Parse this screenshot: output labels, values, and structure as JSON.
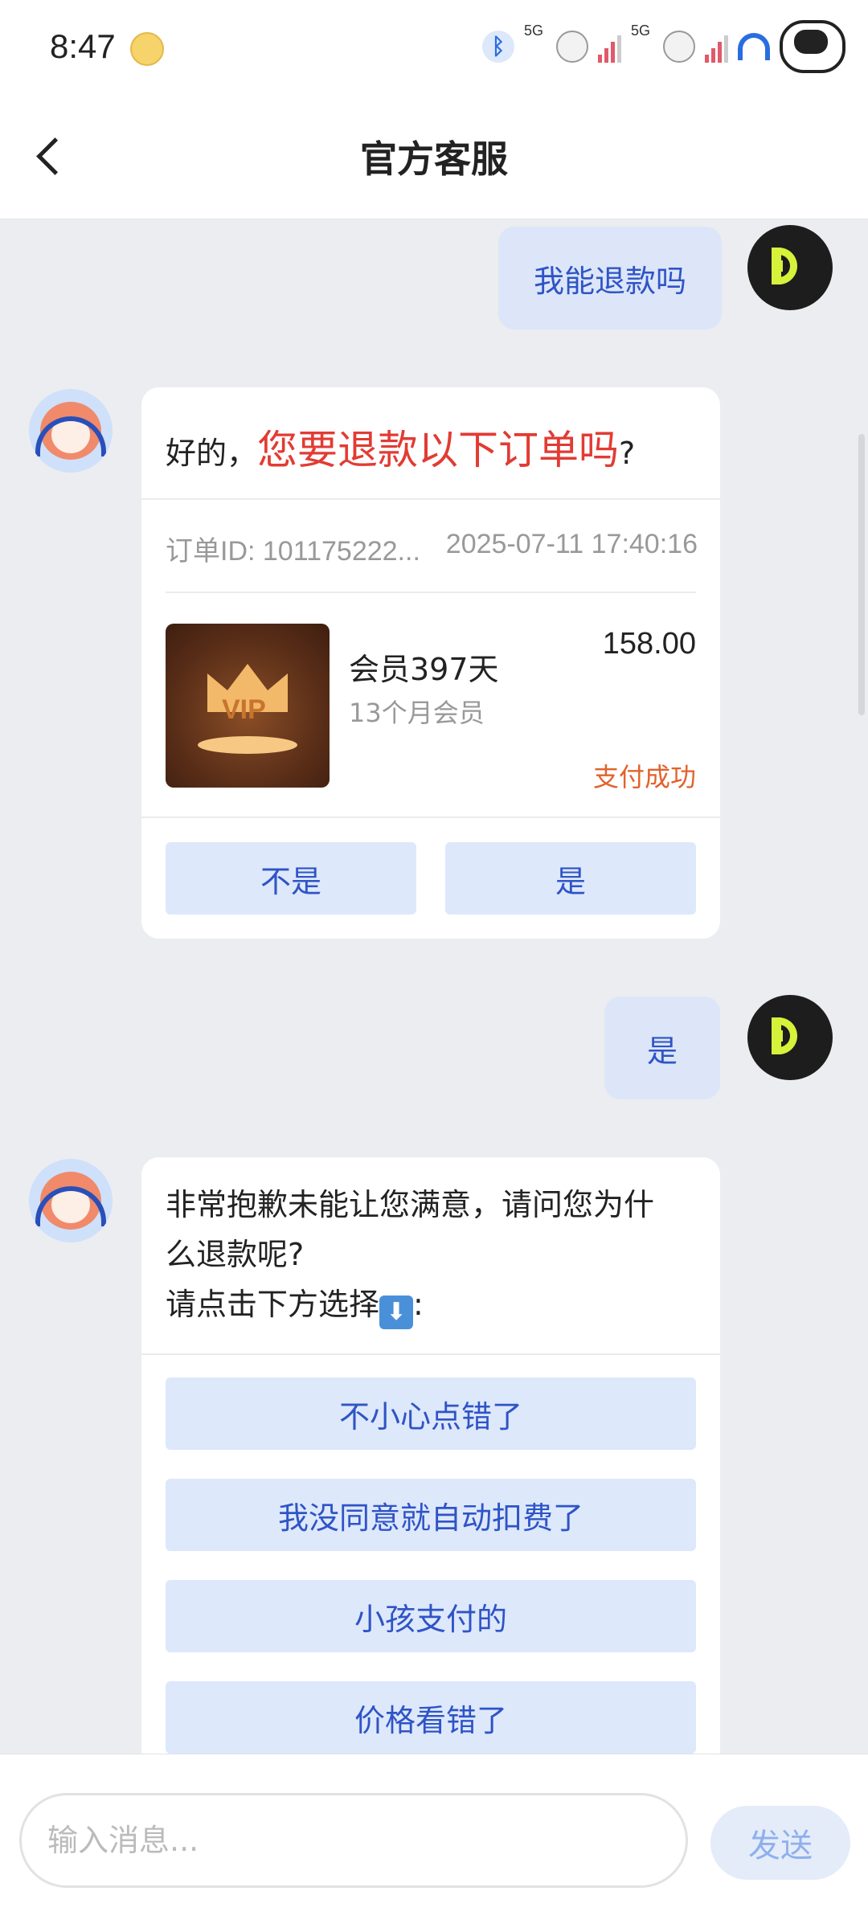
{
  "status_bar": {
    "time": "8:47",
    "icons": [
      "emoji-sticker-icon",
      "bluetooth-icon",
      "signal-5g-icon",
      "signal-5g-icon",
      "wifi-icon",
      "cartoon-avatar-icon"
    ],
    "network_label_1": "5G",
    "network_label_2": "5G"
  },
  "header": {
    "title": "官方客服",
    "back_icon": "chevron-left-icon"
  },
  "messages": {
    "m1": {
      "from": "user",
      "text": "我能退款吗"
    },
    "m2": {
      "from": "bot",
      "question_prefix": "好的，",
      "question_highlight": "您要退款以下订单吗",
      "question_suffix": "?",
      "order": {
        "id_text": "订单ID: 101175222...",
        "datetime": "2025-07-11 17:40:16",
        "image_label": "VIP",
        "product_name": "会员397天",
        "product_sub": "13个月会员",
        "price": "158.00",
        "pay_status": "支付成功"
      },
      "options": [
        "不是",
        "是"
      ]
    },
    "m3": {
      "from": "user",
      "text": "是"
    },
    "m4": {
      "from": "bot",
      "line1": "非常抱歉未能让您满意，请问您为什",
      "line2": "么退款呢?",
      "line3": "请点击下方选择",
      "line3_suffix": ":",
      "arrow_emoji": "⬇",
      "options": [
        "不小心点错了",
        "我没同意就自动扣费了",
        "小孩支付的",
        "价格看错了"
      ]
    }
  },
  "input_bar": {
    "placeholder": "输入消息...",
    "value": "",
    "send_label": "发送"
  },
  "colors": {
    "background": "#ECEDF0",
    "user_bubble": "#DCE6F8",
    "link_blue": "#2F54C6",
    "highlight_red": "#E23B33",
    "status_orange": "#E2622C",
    "option_button": "#DDE8FB"
  }
}
